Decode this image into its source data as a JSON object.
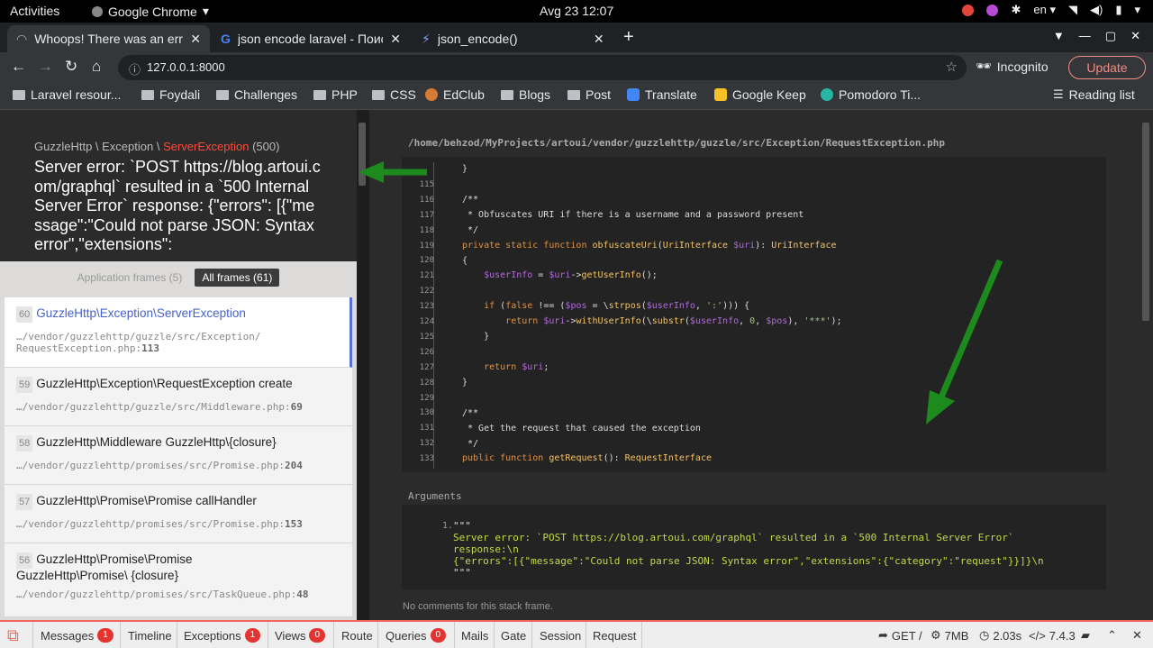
{
  "os": {
    "activities": "Activities",
    "app_name": "Google Chrome",
    "clock": "Avg 23  12:07",
    "lang": "en"
  },
  "tabs": [
    {
      "title": "Whoops! There was an error",
      "active": true
    },
    {
      "title": "json encode laravel - Поиск",
      "active": false
    },
    {
      "title": "json_encode()",
      "active": false
    }
  ],
  "address": {
    "url": "127.0.0.1:8000"
  },
  "profile": {
    "label": "Incognito"
  },
  "update_label": "Update",
  "bookmarks": [
    "Laravel resour...",
    "Foydali",
    "Challenges",
    "PHP",
    "CSS",
    "EdClub",
    "Blogs",
    "Post",
    "Translate",
    "Google Keep",
    "Pomodoro Ti...",
    "Reading list"
  ],
  "exception": {
    "namespace": "GuzzleHttp \\ Exception \\ ",
    "class": "ServerException",
    "code": "(500)",
    "message": "Server error: `POST https://blog.artoui.com/graphql` resulted in a `500 Internal Server Error` response: {\"errors\": [{\"message\":\"Could not parse JSON: Syntax error\",\"extensions\":"
  },
  "frame_tabs": {
    "application": "Application frames (5)",
    "all": "All frames (61)"
  },
  "frames": [
    {
      "num": "60",
      "cls": "GuzzleHttp\\Exception\\ServerException",
      "path": "…/vendor/guzzlehttp/guzzle/src/Exception/ RequestException.php:",
      "line": "113"
    },
    {
      "num": "59",
      "cls": "GuzzleHttp\\Exception\\RequestException create",
      "path": "…/vendor/guzzlehttp/guzzle/src/Middleware.php:",
      "line": "69"
    },
    {
      "num": "58",
      "cls": "GuzzleHttp\\Middleware GuzzleHttp\\{closure}",
      "path": "…/vendor/guzzlehttp/promises/src/Promise.php:",
      "line": "204"
    },
    {
      "num": "57",
      "cls": "GuzzleHttp\\Promise\\Promise callHandler",
      "path": "…/vendor/guzzlehttp/promises/src/Promise.php:",
      "line": "153"
    },
    {
      "num": "56",
      "cls": "GuzzleHttp\\Promise\\Promise GuzzleHttp\\Promise\\ {closure}",
      "path": "…/vendor/guzzlehttp/promises/src/TaskQueue.php:",
      "line": "48"
    }
  ],
  "file_path": "/home/behzod/MyProjects/artoui/vendor/guzzlehttp/guzzle/src/Exception/RequestException.php",
  "code_lines": [
    "",
    "115",
    "116",
    "117",
    "118",
    "119",
    "120",
    "121",
    "122",
    "123",
    "124",
    "125",
    "126",
    "127",
    "128",
    "129",
    "130",
    "131",
    "132",
    "133"
  ],
  "arguments_label": "Arguments",
  "argument": {
    "num": "1.",
    "line1": "\"\"\"",
    "line2": "Server error: `POST https://blog.artoui.com/graphql` resulted in a `500 Internal Server Error`",
    "line3": "response:\\n",
    "line4": "{\"errors\":[{\"message\":\"Could not parse JSON: Syntax error\",\"extensions\":{\"category\":\"request\"}}]}\\n",
    "line5": "\"\"\""
  },
  "no_comments": "No comments for this stack frame.",
  "debugbar": {
    "messages": "Messages",
    "messages_count": "1",
    "timeline": "Timeline",
    "exceptions": "Exceptions",
    "exceptions_count": "1",
    "views": "Views",
    "views_count": "0",
    "route": "Route",
    "queries": "Queries",
    "queries_count": "0",
    "mails": "Mails",
    "gate": "Gate",
    "session": "Session",
    "request": "Request",
    "method": "GET /",
    "memory": "7MB",
    "time": "2.03s",
    "php": "7.4.3"
  }
}
